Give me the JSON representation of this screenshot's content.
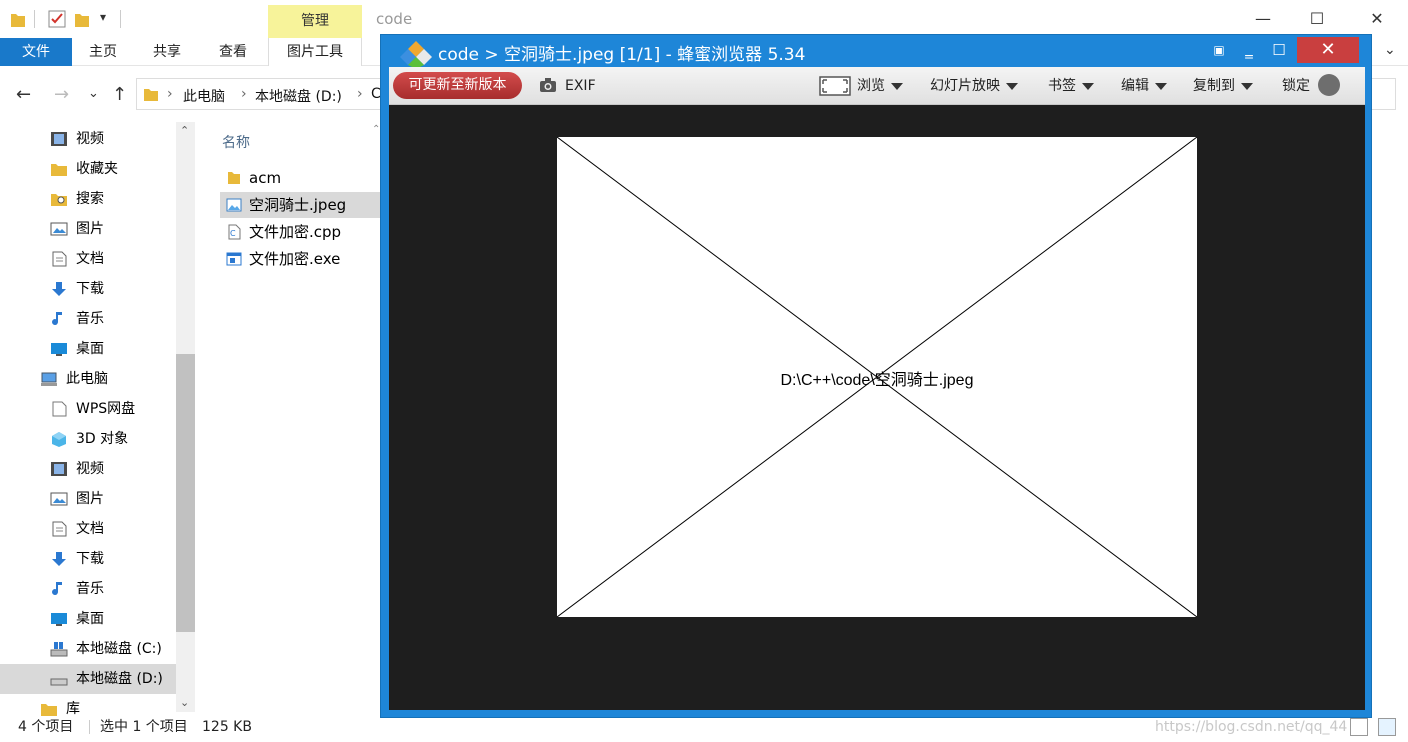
{
  "explorer": {
    "title": "code",
    "manage_tab": "管理",
    "ribbon_tabs": [
      "文件",
      "主页",
      "共享",
      "查看",
      "图片工具"
    ],
    "address": [
      "此电脑",
      "本地磁盘 (D:)",
      "C"
    ],
    "column_name": "名称",
    "nav_items": [
      {
        "label": "视频",
        "icon": "video-icon"
      },
      {
        "label": "收藏夹",
        "icon": "favorites-folder-icon"
      },
      {
        "label": "搜索",
        "icon": "search-folder-icon"
      },
      {
        "label": "图片",
        "icon": "pictures-icon"
      },
      {
        "label": "文档",
        "icon": "documents-icon"
      },
      {
        "label": "下载",
        "icon": "download-icon"
      },
      {
        "label": "音乐",
        "icon": "music-icon"
      },
      {
        "label": "桌面",
        "icon": "desktop-icon"
      },
      {
        "label": "此电脑",
        "icon": "computer-icon"
      },
      {
        "label": "WPS网盘",
        "icon": "wps-drive-icon"
      },
      {
        "label": "3D 对象",
        "icon": "3d-objects-icon"
      },
      {
        "label": "视频",
        "icon": "video-icon"
      },
      {
        "label": "图片",
        "icon": "pictures-icon"
      },
      {
        "label": "文档",
        "icon": "documents-icon"
      },
      {
        "label": "下载",
        "icon": "download-icon"
      },
      {
        "label": "音乐",
        "icon": "music-icon"
      },
      {
        "label": "桌面",
        "icon": "desktop-icon"
      },
      {
        "label": "本地磁盘 (C:)",
        "icon": "drive-c-icon"
      },
      {
        "label": "本地磁盘 (D:)",
        "icon": "drive-d-icon"
      },
      {
        "label": "库",
        "icon": "library-icon"
      }
    ],
    "files": [
      {
        "name": "acm",
        "icon": "folder-icon"
      },
      {
        "name": "空洞骑士.jpeg",
        "icon": "image-file-icon"
      },
      {
        "name": "文件加密.cpp",
        "icon": "cpp-file-icon"
      },
      {
        "name": "文件加密.exe",
        "icon": "exe-file-icon"
      }
    ],
    "status": {
      "count": "4 个项目",
      "selected": "选中 1 个项目",
      "size": "125 KB"
    }
  },
  "viewer": {
    "title": "code > 空洞骑士.jpeg [1/1] - 蜂蜜浏览器 5.34",
    "update_button": "可更新至新版本",
    "exif": "EXIF",
    "browse": "浏览",
    "slideshow": "幻灯片放映",
    "bookmarks": "书签",
    "edit": "编辑",
    "copy_to": "复制到",
    "lock": "锁定",
    "image_caption": "D:\\C++\\code\\空洞骑士.jpeg"
  },
  "watermark": "https://blog.csdn.net/qq_44"
}
